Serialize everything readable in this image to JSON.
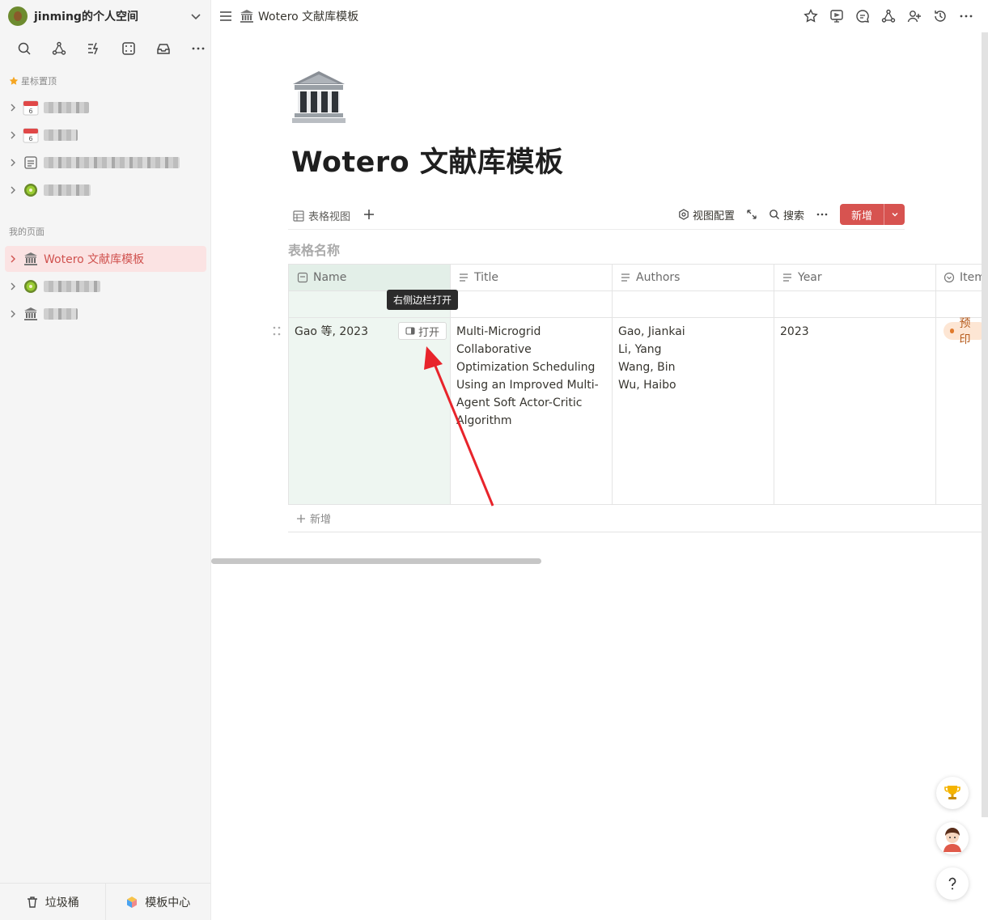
{
  "sidebar": {
    "workspace_name": "jinming的个人空间",
    "starred_label": "星标置顶",
    "my_pages_label": "我的页面",
    "active_page_label": "Wotero 文献库模板",
    "trash_label": "垃圾桶",
    "template_center_label": "模板中心",
    "icons": [
      "search-icon",
      "graph-icon",
      "quick-icon",
      "gallery-icon",
      "inbox-icon",
      "more-icon"
    ]
  },
  "topbar": {
    "breadcrumb": "Wotero 文献库模板"
  },
  "page": {
    "title": "Wotero 文献库模板",
    "view_tab": "表格视图",
    "view_config": "视图配置",
    "search": "搜索",
    "new_button": "新增",
    "table_name": "表格名称"
  },
  "table": {
    "columns": [
      "Name",
      "Title",
      "Authors",
      "Year",
      "Item"
    ],
    "rows": [
      {
        "name": "Gao 等, 2023",
        "open_label": "打开",
        "title": "Multi-Microgrid Collaborative Optimization Scheduling Using an Improved Multi-Agent Soft Actor-Critic Algorithm",
        "authors": [
          "Gao, Jiankai",
          "Li, Yang",
          "Wang, Bin",
          "Wu, Haibo"
        ],
        "year": "2023",
        "item_type": "预印"
      }
    ],
    "add_row_label": "新增"
  },
  "tooltip": "右侧边栏打开",
  "colors": {
    "accent": "#d75350",
    "active_bg": "#fbe3e3",
    "name_col_bg": "#eef6f1",
    "arrow": "#e8242b"
  }
}
